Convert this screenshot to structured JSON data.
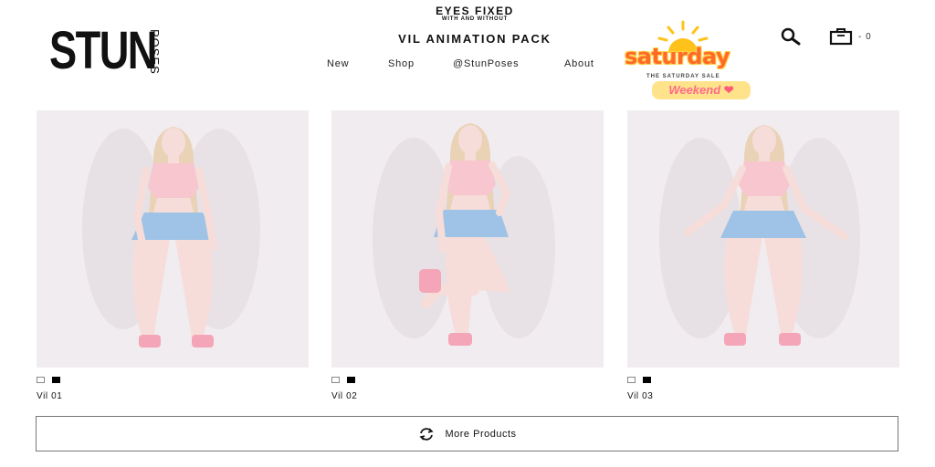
{
  "brand": {
    "logo_main": "STUN",
    "logo_sub": "POSES"
  },
  "banner": {
    "line1": "EYES FIXED",
    "line2": "WITH AND WITHOUT"
  },
  "pack_title": "VIL ANIMATION PACK",
  "nav": {
    "items": [
      {
        "label": "New"
      },
      {
        "label": "Shop"
      },
      {
        "label": "@StunPoses"
      },
      {
        "label": "About"
      }
    ]
  },
  "sale_badge": {
    "title": "saturday",
    "subtitle": "THE SATURDAY SALE",
    "tag": "Weekend"
  },
  "cart": {
    "count": "- 0"
  },
  "colors": {
    "skirt": "#9fc3e6",
    "top": "#f7c6cf",
    "hair": "#e9d2b6",
    "skin": "#f6ddd9",
    "shoes": "#f4a6b8",
    "card_bg": "#f1ecef"
  },
  "products": [
    {
      "name": "Vil 01"
    },
    {
      "name": "Vil 02"
    },
    {
      "name": "Vil 03"
    }
  ],
  "more_button": {
    "label": "More Products"
  }
}
